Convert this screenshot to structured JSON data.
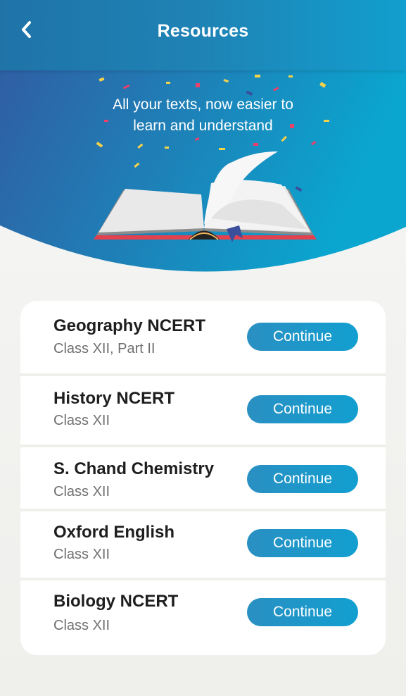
{
  "header": {
    "title": "Resources",
    "back_icon": "chevron-left-icon"
  },
  "hero": {
    "tagline_line1": "All your texts, now easier to",
    "tagline_line2": "learn and understand",
    "illustration": "open-book-with-confetti",
    "colors": {
      "from": "#2e5aa0",
      "to": "#0ea3cd"
    }
  },
  "resources": [
    {
      "title": "Geography NCERT",
      "subtitle": "Class XII, Part II",
      "action": "Continue"
    },
    {
      "title": "History NCERT",
      "subtitle": "Class XII",
      "action": "Continue"
    },
    {
      "title": "S. Chand Chemistry",
      "subtitle": "Class XII",
      "action": "Continue"
    },
    {
      "title": "Oxford English",
      "subtitle": "Class XII",
      "action": "Continue"
    },
    {
      "title": "Biology NCERT",
      "subtitle": "Class XII",
      "action": "Continue"
    }
  ],
  "colors": {
    "accent": "#1a9ccc",
    "header": "#1f7fb3"
  }
}
